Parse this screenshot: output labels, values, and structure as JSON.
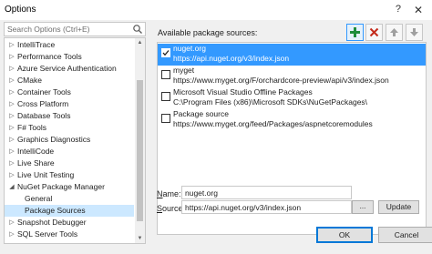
{
  "window": {
    "title": "Options",
    "help_glyph": "?",
    "close_glyph": "✕"
  },
  "search": {
    "placeholder": "Search Options (Ctrl+E)",
    "icon": "search-icon"
  },
  "tree": {
    "items": [
      {
        "label": "IntelliTrace",
        "expanded": false,
        "level": 0
      },
      {
        "label": "Performance Tools",
        "expanded": false,
        "level": 0
      },
      {
        "label": "Azure Service Authentication",
        "expanded": false,
        "level": 0
      },
      {
        "label": "CMake",
        "expanded": false,
        "level": 0
      },
      {
        "label": "Container Tools",
        "expanded": false,
        "level": 0
      },
      {
        "label": "Cross Platform",
        "expanded": false,
        "level": 0
      },
      {
        "label": "Database Tools",
        "expanded": false,
        "level": 0
      },
      {
        "label": "F# Tools",
        "expanded": false,
        "level": 0
      },
      {
        "label": "Graphics Diagnostics",
        "expanded": false,
        "level": 0
      },
      {
        "label": "IntelliCode",
        "expanded": false,
        "level": 0
      },
      {
        "label": "Live Share",
        "expanded": false,
        "level": 0
      },
      {
        "label": "Live Unit Testing",
        "expanded": false,
        "level": 0
      },
      {
        "label": "NuGet Package Manager",
        "expanded": true,
        "level": 0
      },
      {
        "label": "General",
        "level": 1
      },
      {
        "label": "Package Sources",
        "level": 1,
        "selected": true
      },
      {
        "label": "Snapshot Debugger",
        "expanded": false,
        "level": 0
      },
      {
        "label": "SQL Server Tools",
        "expanded": false,
        "level": 0
      }
    ]
  },
  "sources_panel": {
    "label": "Available package sources:",
    "toolbar": {
      "add_icon": "plus-icon",
      "remove_icon": "x-icon",
      "up_icon": "arrow-up-icon",
      "down_icon": "arrow-down-icon"
    },
    "items": [
      {
        "name": "nuget.org",
        "url": "https://api.nuget.org/v3/index.json",
        "checked": true,
        "selected": true
      },
      {
        "name": "myget",
        "url": "https://www.myget.org/F/orchardcore-preview/api/v3/index.json",
        "checked": false,
        "selected": false
      },
      {
        "name": "Microsoft Visual Studio Offline Packages",
        "url": "C:\\Program Files (x86)\\Microsoft SDKs\\NuGetPackages\\",
        "checked": false,
        "selected": false
      },
      {
        "name": "Package source",
        "url": "https://www.myget.org/feed/Packages/aspnetcoremodules",
        "checked": false,
        "selected": false
      }
    ]
  },
  "fields": {
    "name_label_accel": "N",
    "name_label_rest": "ame:",
    "name_value": "nuget.org",
    "source_label_accel": "S",
    "source_label_rest": "ource:",
    "source_value": "https://api.nuget.org/v3/index.json",
    "browse_label": "...",
    "update_label": "Update"
  },
  "buttons": {
    "ok_label": "OK",
    "cancel_label": "Cancel"
  },
  "colors": {
    "selection": "#3399ff",
    "tree_selection": "#cce8ff",
    "add_green": "#1e8c3a",
    "remove_red": "#c42b1c"
  }
}
